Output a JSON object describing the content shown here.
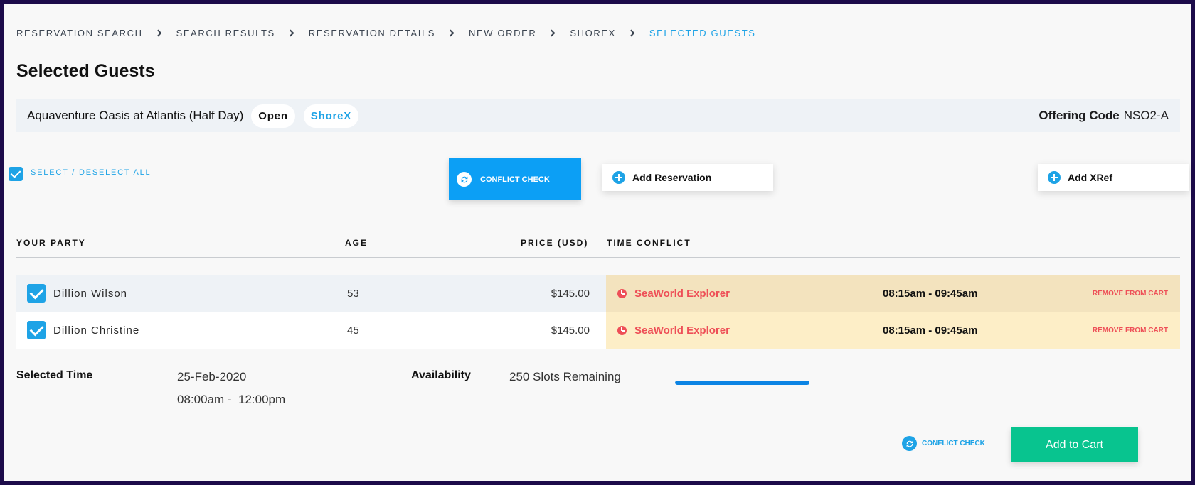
{
  "breadcrumb": [
    "RESERVATION SEARCH",
    "SEARCH RESULTS",
    "RESERVATION DETAILS",
    "NEW ORDER",
    "SHOREX",
    "SELECTED GUESTS"
  ],
  "page_title": "Selected Guests",
  "offering": {
    "name": "Aquaventure Oasis at Atlantis (Half Day)",
    "status": "Open",
    "category": "ShoreX",
    "code_label": "Offering Code",
    "code_value": "NSO2-A"
  },
  "toolbar": {
    "select_all_label": "SELECT / DESELECT ALL",
    "select_all_checked": true,
    "conflict_check_label": "CONFLICT CHECK",
    "add_reservation_label": "Add Reservation",
    "add_xref_label": "Add XRef"
  },
  "table": {
    "columns": [
      "YOUR PARTY",
      "AGE",
      "PRICE (USD)",
      "TIME CONFLICT"
    ],
    "rows": [
      {
        "checked": true,
        "name": "Dillion Wilson",
        "age": "53",
        "price": "$145.00",
        "conflict_name": "SeaWorld Explorer",
        "conflict_time": "08:15am - 09:45am",
        "remove_label": "REMOVE FROM CART"
      },
      {
        "checked": true,
        "name": "Dillion Christine",
        "age": "45",
        "price": "$145.00",
        "conflict_name": "SeaWorld Explorer",
        "conflict_time": "08:15am - 09:45am",
        "remove_label": "REMOVE FROM CART"
      }
    ]
  },
  "selection": {
    "time_label": "Selected Time",
    "date": "25-Feb-2020",
    "time_range": "08:00am -  12:00pm",
    "availability_label": "Availability",
    "availability_text": "250 Slots Remaining",
    "availability_fill_percent": 100
  },
  "footer": {
    "conflict_check_label": "CONFLICT CHECK",
    "add_to_cart_label": "Add to Cart"
  },
  "colors": {
    "accent": "#1ea3e6",
    "conflict_red": "#ee4f57",
    "cart_green": "#08c48f",
    "frame": "#1c0b4a"
  },
  "icons": [
    "chevron-right-icon",
    "checkbox-checked-icon",
    "sync-icon",
    "plus-circle-icon",
    "clock-alert-icon"
  ]
}
